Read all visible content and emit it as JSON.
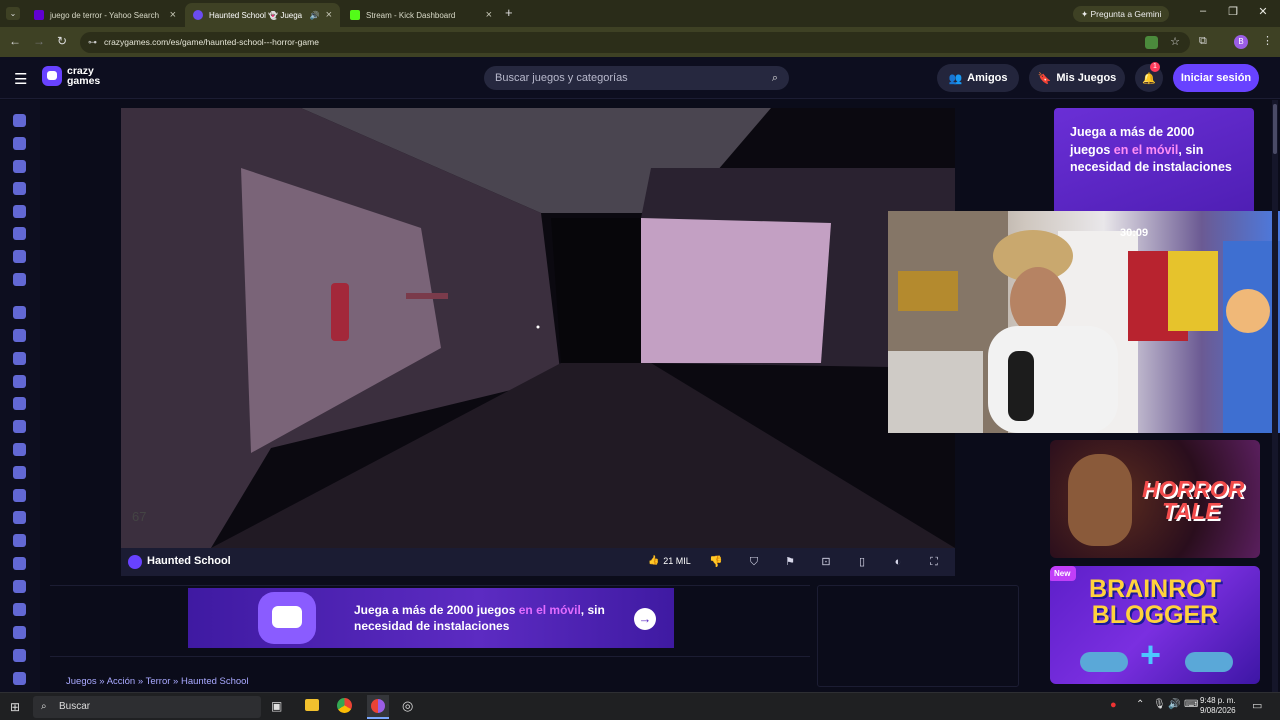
{
  "browser": {
    "tabs": [
      {
        "title": "juego de terror - Yahoo Search",
        "favicon_color": "#6001d2"
      },
      {
        "title": "Haunted School 👻 Juega",
        "favicon_color": "#6b4cf0"
      },
      {
        "title": "Stream - Kick Dashboard",
        "favicon_color": "#53fc18"
      }
    ],
    "gemini_label": "Pregunta a Gemini",
    "url": "crazygames.com/es/game/haunted-school---horror-game",
    "profile_initial": "B"
  },
  "site": {
    "logo_line1": "crazy",
    "logo_line2": "games",
    "search_placeholder": "Buscar juegos y categorías",
    "friends_label": "Amigos",
    "mygames_label": "Mis Juegos",
    "notification_count": "1",
    "login_label": "Iniciar sesión"
  },
  "game": {
    "title": "Haunted School",
    "likes": "21 MIL",
    "fps": "67"
  },
  "promo_banner": {
    "text_a": "Juega a más de 2000 juegos ",
    "text_highlight": "en el móvil",
    "text_b": ", sin necesidad de instalaciones"
  },
  "ad_top": {
    "line_a": "Juega a más de 2000 juegos ",
    "highlight": "en el móvil",
    "line_b": ", sin necesidad de instalaciones"
  },
  "webcam": {
    "clock": "30:09"
  },
  "cards": [
    {
      "title_line1": "HORROR",
      "title_line2": "TALE"
    },
    {
      "badge": "New",
      "title_line1": "BRAINROT",
      "title_line2": "BLOGGER"
    }
  ],
  "breadcrumb": [
    "Juegos",
    "Acción",
    "Terror",
    "Haunted School"
  ],
  "taskbar": {
    "search_label": "Buscar",
    "time": "9:48 p. m.",
    "date": "9/08/2026"
  },
  "colors": {
    "accent": "#6842ff",
    "header_bg": "#0d0e1f",
    "highlight_pink": "#e26cff"
  }
}
